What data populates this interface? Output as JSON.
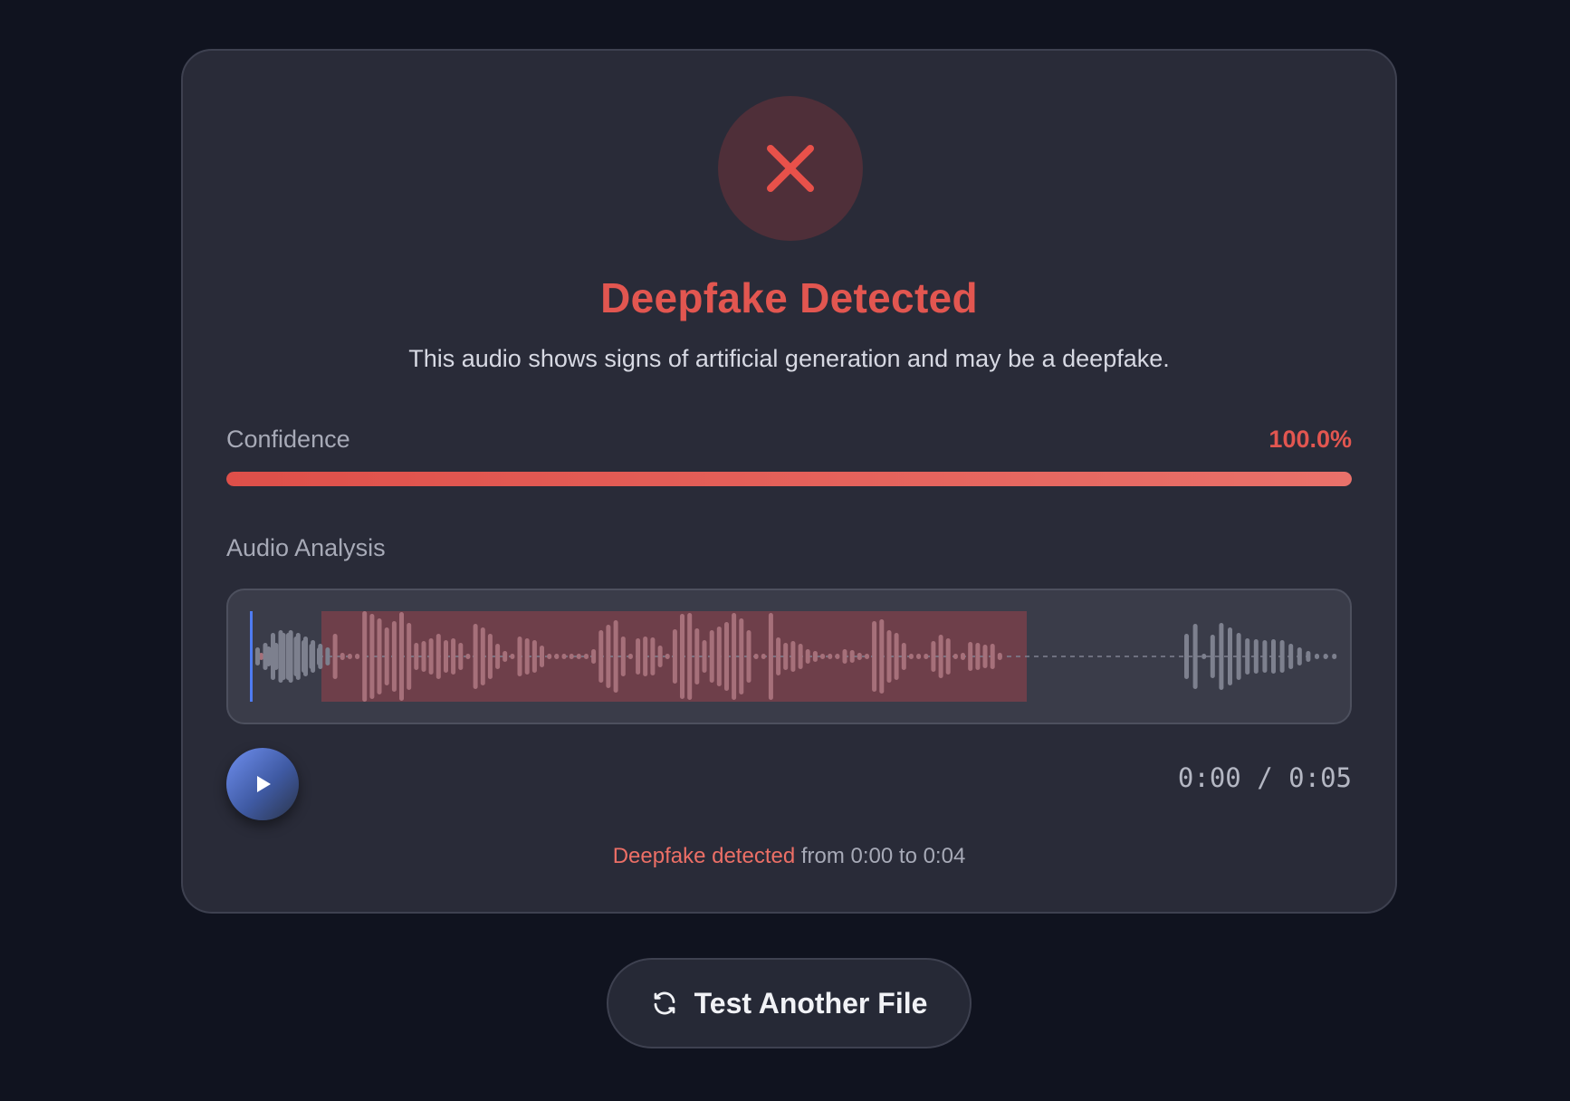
{
  "result": {
    "title": "Deepfake Detected",
    "description": "This audio shows signs of artificial generation and may be a deepfake.",
    "status_icon": "x-icon",
    "accent_color": "#e25650"
  },
  "confidence": {
    "label": "Confidence",
    "value_text": "100.0%",
    "fraction": 1.0
  },
  "analysis": {
    "label": "Audio Analysis",
    "duration_seconds": 5,
    "flagged_start_seconds": 0,
    "flagged_end_seconds": 4,
    "playhead_seconds": 0
  },
  "player": {
    "play_icon": "play-icon",
    "current_time": "0:00",
    "separator": "/",
    "total_time": "0:05"
  },
  "detection_note": {
    "highlight": "Deepfake detected",
    "rest": " from 0:00 to 0:04"
  },
  "actions": {
    "test_another_label": "Test Another File",
    "test_another_icon": "refresh-icon"
  }
}
